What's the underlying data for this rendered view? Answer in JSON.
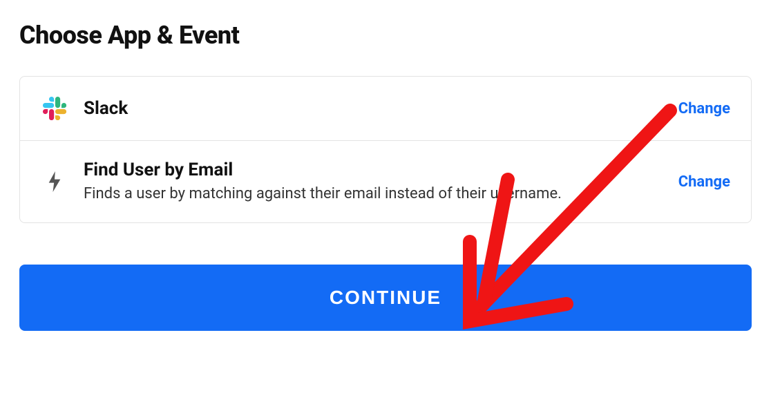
{
  "header": {
    "title": "Choose App & Event"
  },
  "rows": {
    "app": {
      "name": "Slack",
      "change_label": "Change"
    },
    "event": {
      "title": "Find User by Email",
      "description": "Finds a user by matching against their email instead of their username.",
      "change_label": "Change"
    }
  },
  "actions": {
    "continue_label": "CONTINUE"
  },
  "icons": {
    "slack": "slack-icon",
    "bolt": "bolt-icon"
  },
  "colors": {
    "accent": "#136bf5",
    "annotation": "#ef1515"
  }
}
